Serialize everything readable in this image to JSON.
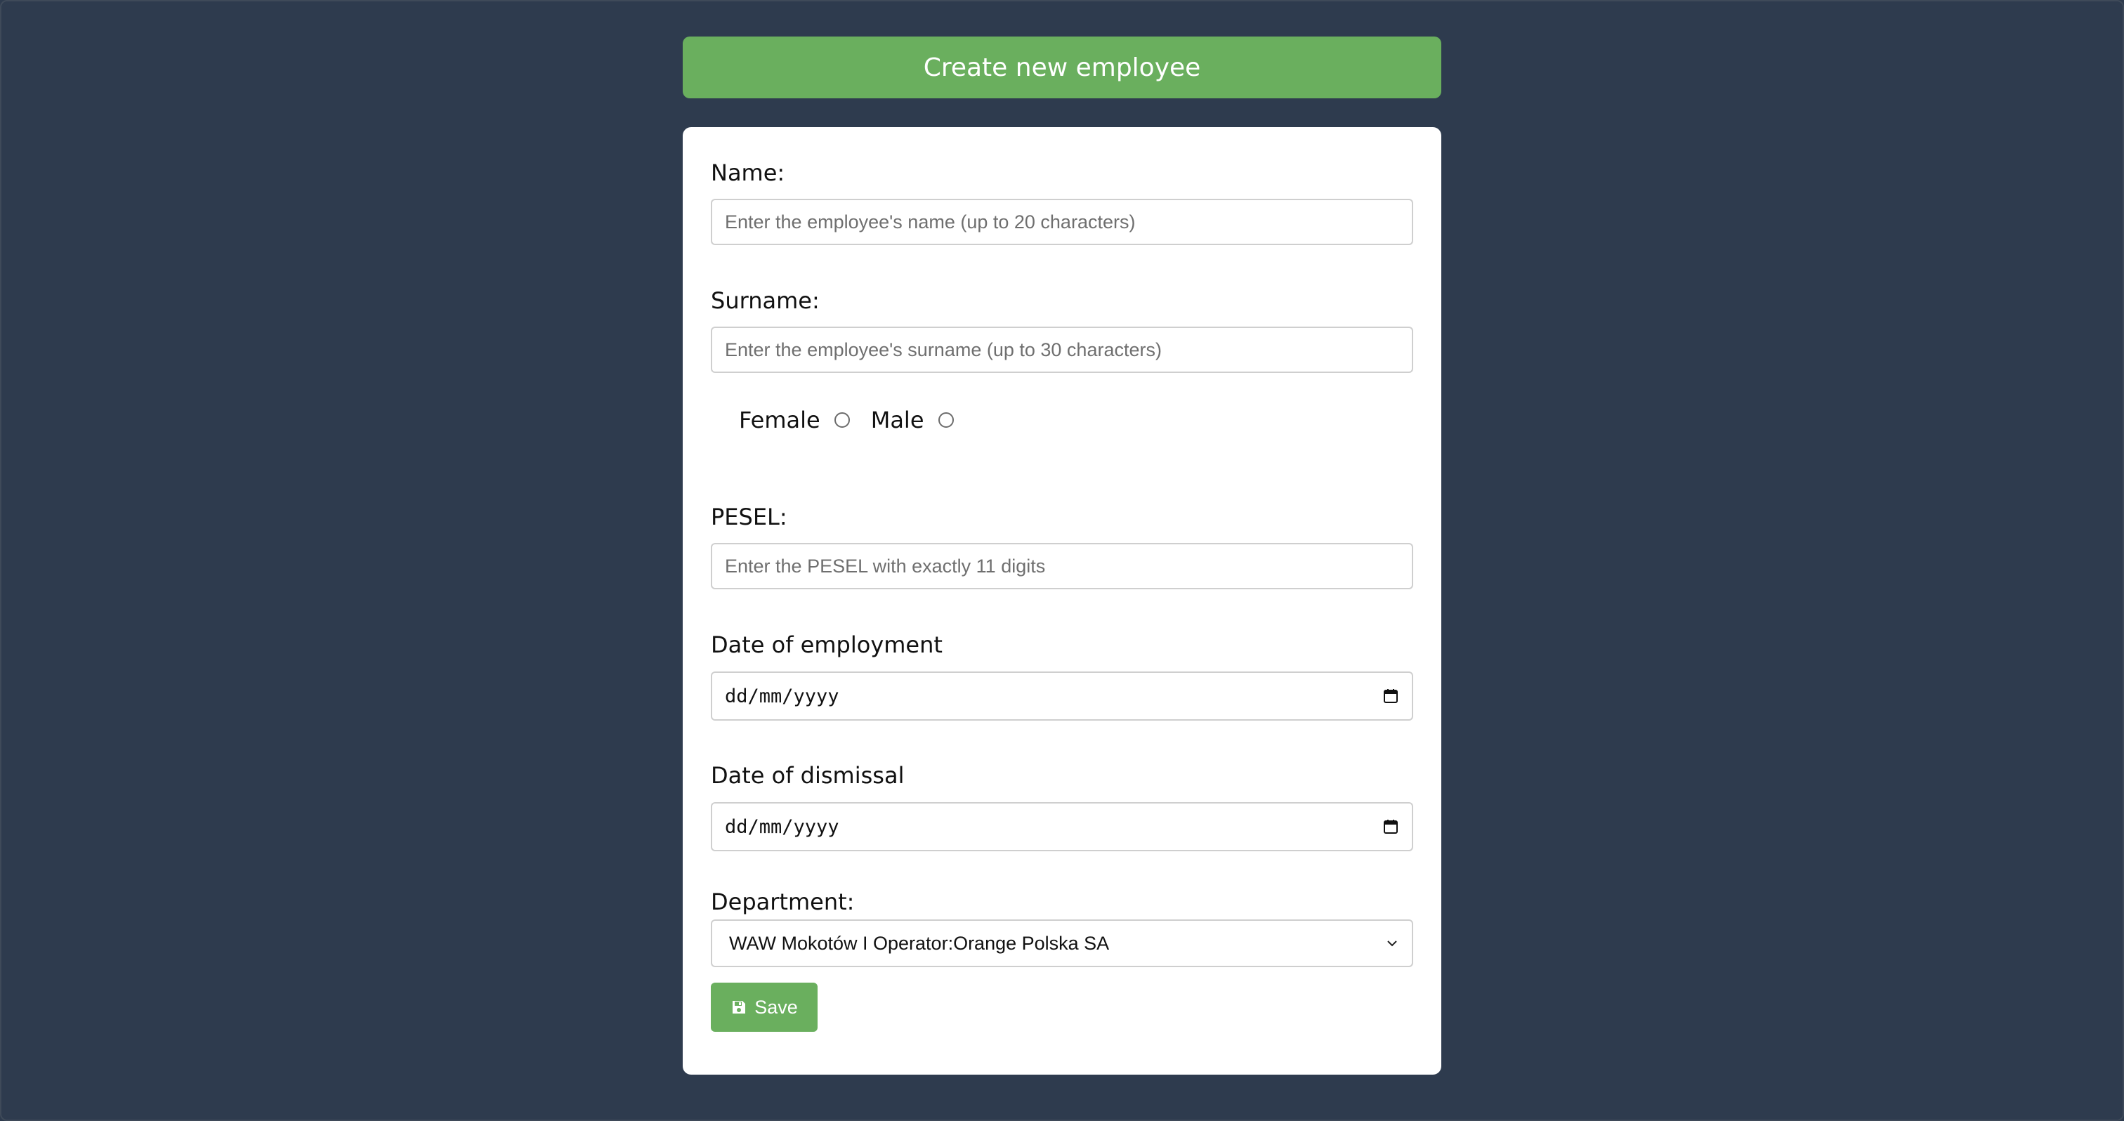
{
  "header": {
    "title": "Create new employee"
  },
  "form": {
    "name": {
      "label": "Name:",
      "placeholder": "Enter the employee's name (up to 20 characters)",
      "value": ""
    },
    "surname": {
      "label": "Surname:",
      "placeholder": "Enter the employee's surname (up to 30 characters)",
      "value": ""
    },
    "gender": {
      "options": [
        {
          "label": "Female",
          "selected": false
        },
        {
          "label": "Male",
          "selected": false
        }
      ]
    },
    "pesel": {
      "label": "PESEL:",
      "placeholder": "Enter the PESEL with exactly 11 digits",
      "value": ""
    },
    "employment_date": {
      "label": "Date of employment",
      "value": "dd/mm/yyyy"
    },
    "dismissal_date": {
      "label": "Date of dismissal",
      "value": "dd/mm/yyyy"
    },
    "department": {
      "label": "Department:",
      "selected": "WAW Mokotów I Operator:Orange Polska SA"
    },
    "save_label": "Save"
  },
  "colors": {
    "background": "#2e3b4e",
    "accent": "#6aaf5e",
    "card": "#ffffff"
  },
  "icons": {
    "save": "floppy-disk-icon",
    "calendar": "calendar-icon",
    "dropdown": "chevron-down-icon"
  }
}
